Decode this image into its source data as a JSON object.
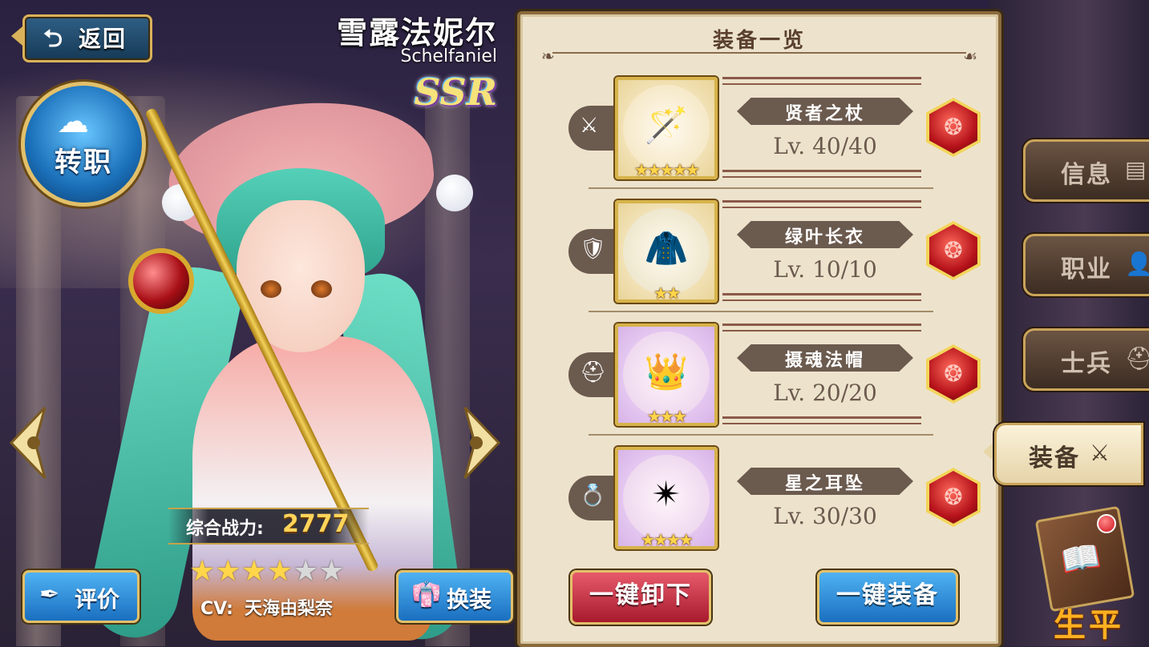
{
  "header": {
    "back_icon": "⮌",
    "back_label": "返回",
    "character_name": "雪露法妮尔",
    "character_name_en": "Schelfaniel",
    "rarity": "SSR"
  },
  "class_change": {
    "label": "转职",
    "icon": "☁"
  },
  "character": {
    "power_label": "综合战力:",
    "power_value": "2777",
    "stars_filled": 4,
    "stars_total": 6,
    "stars_on": [
      "★",
      "★",
      "★",
      "★"
    ],
    "stars_off": [
      "★",
      "★"
    ],
    "cv_label": "CV:",
    "cv_name": "天海由梨奈"
  },
  "buttons": {
    "review_label": "评价",
    "review_icon": "✒",
    "outfit_label": "换装",
    "outfit_icon": "👘"
  },
  "equipment_panel": {
    "title": "装备一览",
    "items": [
      {
        "slot_icon": "⚔",
        "slot": "sword-icon",
        "name": "贤者之杖",
        "level": "Lv. 40/40",
        "stars": "★★★★★",
        "art": "🪄"
      },
      {
        "slot_icon": "🛡",
        "slot": "armor-icon",
        "name": "绿叶长衣",
        "level": "Lv. 10/10",
        "stars": "★★",
        "art": "🧥"
      },
      {
        "slot_icon": "⛑",
        "slot": "helmet-icon",
        "name": "摄魂法帽",
        "level": "Lv. 20/20",
        "stars": "★★★",
        "art": "👑"
      },
      {
        "slot_icon": "💍",
        "slot": "ring-icon",
        "name": "星之耳坠",
        "level": "Lv. 30/30",
        "stars": "★★★★",
        "art": "✴"
      }
    ],
    "gem_icon": "❂",
    "unequip_all": "一键卸下",
    "equip_all": "一键装备"
  },
  "tabs": [
    {
      "label": "信息",
      "icon": "▤",
      "active": false
    },
    {
      "label": "职业",
      "icon": "👤",
      "active": false
    },
    {
      "label": "士兵",
      "icon": "⛑",
      "active": false
    },
    {
      "label": "装备",
      "icon": "⚔",
      "active": true
    }
  ],
  "biography": {
    "label": "生平",
    "icon": "📖"
  },
  "colors": {
    "gold_border": "#d9b25a",
    "blue_button": "#1a6fc0",
    "red_button": "#a81a2e",
    "panel_bg": "#ede3cc",
    "power_value": "#ffd45a",
    "bio_label": "#ffb020"
  }
}
